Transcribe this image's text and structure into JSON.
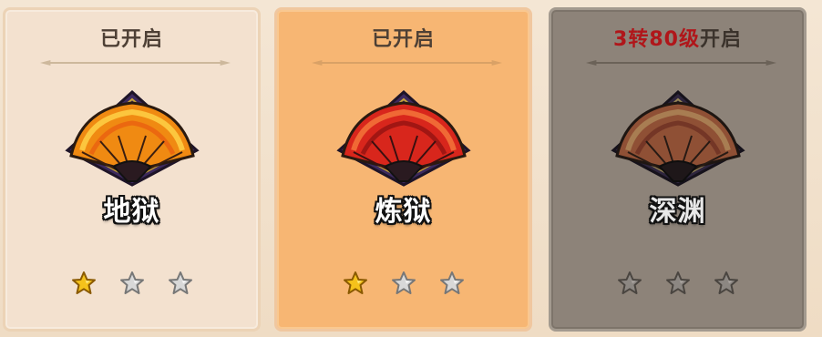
{
  "cards": [
    {
      "status_text": "已开启",
      "status_text_emph": "",
      "mode_name": "地狱",
      "fan_icon": "orange-folding-fan-icon",
      "stars_total": 3,
      "stars_filled": 1,
      "state": "opened"
    },
    {
      "status_text": "已开启",
      "status_text_emph": "",
      "mode_name": "炼狱",
      "fan_icon": "red-folding-fan-icon",
      "stars_total": 3,
      "stars_filled": 1,
      "state": "selected"
    },
    {
      "status_text": "开启",
      "status_text_emph": "3转80级",
      "mode_name": "深渊",
      "fan_icon": "dim-folding-fan-icon",
      "stars_total": 3,
      "stars_filled": 0,
      "state": "locked"
    }
  ],
  "colors": {
    "opened_card_bg": "#f3e1cf",
    "selected_card_bg": "#f7b673",
    "locked_card_bg": "#8d8379",
    "requirement_red": "#b0161a",
    "star_gold": "#f5c21b",
    "star_silver": "#d8d8d8"
  }
}
